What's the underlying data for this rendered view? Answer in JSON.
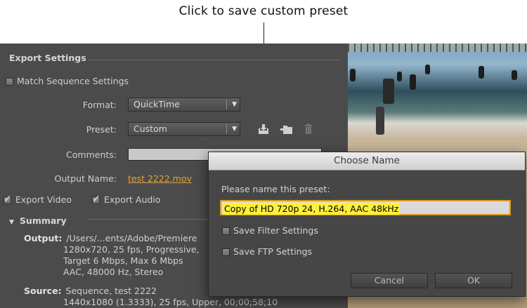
{
  "callout": {
    "text": "Click to save custom preset"
  },
  "export_settings": {
    "section_title": "Export Settings",
    "match_sequence_label": "Match Sequence Settings",
    "match_sequence_checked": false,
    "format_label": "Format:",
    "format_value": "QuickTime",
    "preset_label": "Preset:",
    "preset_value": "Custom",
    "comments_label": "Comments:",
    "comments_value": "",
    "output_name_label": "Output Name:",
    "output_name_value": "test 2222.mov",
    "export_video_label": "Export Video",
    "export_video_checked": true,
    "export_audio_label": "Export Audio",
    "export_audio_checked": true,
    "preset_icons": [
      "save-preset-icon",
      "import-preset-icon",
      "delete-preset-icon"
    ]
  },
  "summary": {
    "title": "Summary",
    "output_label": "Output:",
    "output_lines": [
      "/Users/...ents/Adobe/Premiere",
      "1280x720, 25 fps, Progressive,",
      "Target 6 Mbps, Max 6 Mbps",
      "AAC, 48000 Hz, Stereo"
    ],
    "source_label": "Source:",
    "source_lines": [
      "Sequence, test 2222",
      "1440x1080 (1.3333), 25 fps, Upper, 00;00;58;10"
    ]
  },
  "dialog": {
    "title": "Choose Name",
    "prompt": "Please name this preset:",
    "name_value": "Copy of HD 720p 24, H.264, AAC 48kHz",
    "save_filter_label": "Save Filter Settings",
    "save_filter_checked": false,
    "save_ftp_label": "Save FTP Settings",
    "save_ftp_checked": false,
    "cancel_label": "Cancel",
    "ok_label": "OK"
  },
  "colors": {
    "panel_bg": "#4b4b4b",
    "link": "#e0a43a",
    "highlight": "#ffef3a",
    "focus_border": "#d69b19"
  }
}
